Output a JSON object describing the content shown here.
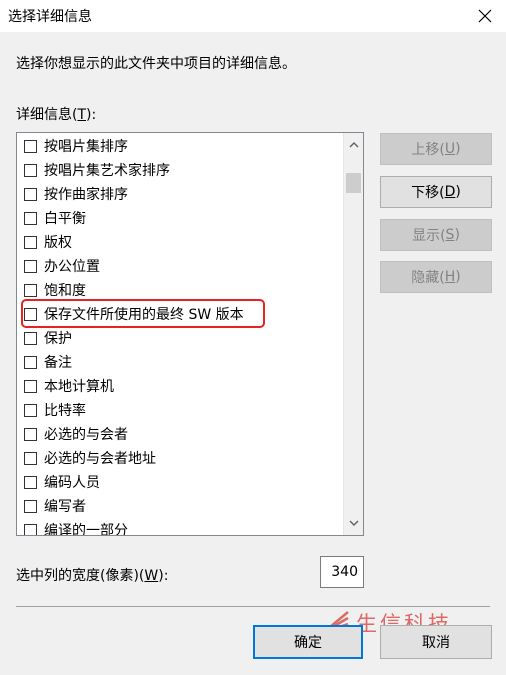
{
  "window": {
    "title": "选择详细信息",
    "close_icon": "close-icon"
  },
  "description": "选择你想显示的此文件夹中项目的详细信息。",
  "details_label": {
    "text": "详细信息(",
    "key": "T",
    "suffix": "):"
  },
  "items": [
    {
      "label": "按唱片集排序",
      "checked": false
    },
    {
      "label": "按唱片集艺术家排序",
      "checked": false
    },
    {
      "label": "按作曲家排序",
      "checked": false
    },
    {
      "label": "白平衡",
      "checked": false
    },
    {
      "label": "版权",
      "checked": false
    },
    {
      "label": "办公位置",
      "checked": false
    },
    {
      "label": "饱和度",
      "checked": false
    },
    {
      "label": "保存文件所使用的最终 SW 版本",
      "checked": false,
      "highlighted": true
    },
    {
      "label": "保护",
      "checked": false
    },
    {
      "label": "备注",
      "checked": false
    },
    {
      "label": "本地计算机",
      "checked": false
    },
    {
      "label": "比特率",
      "checked": false
    },
    {
      "label": "必选的与会者",
      "checked": false
    },
    {
      "label": "必选的与会者地址",
      "checked": false
    },
    {
      "label": "编码人员",
      "checked": false
    },
    {
      "label": "编写者",
      "checked": false
    },
    {
      "label": "编译的一部分",
      "checked": false
    }
  ],
  "buttons": {
    "move_up": {
      "text": "上移(",
      "key": "U",
      "suffix": ")",
      "enabled": false
    },
    "move_down": {
      "text": "下移(",
      "key": "D",
      "suffix": ")",
      "enabled": true
    },
    "show": {
      "text": "显示(",
      "key": "S",
      "suffix": ")",
      "enabled": false
    },
    "hide": {
      "text": "隐藏(",
      "key": "H",
      "suffix": ")",
      "enabled": false
    },
    "ok": "确定",
    "cancel": "取消"
  },
  "width_field": {
    "label": "选中列的宽度(像素)(",
    "key": "W",
    "suffix": "):",
    "value": "340"
  },
  "watermark": {
    "text": "生信科技"
  },
  "colors": {
    "accent": "#0078d7",
    "highlight": "#e8221f",
    "watermark": "#d9534f"
  }
}
